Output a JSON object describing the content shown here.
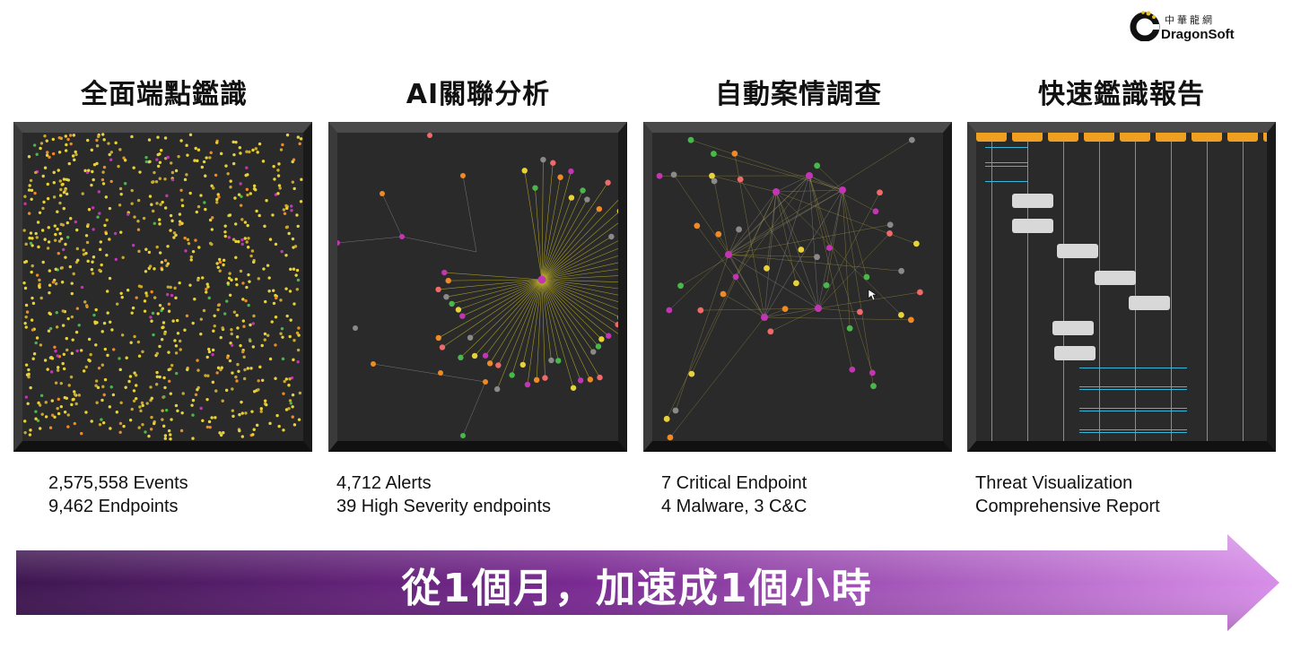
{
  "logo": {
    "cn": "中華龍網",
    "en": "DragonSoft"
  },
  "columns": [
    {
      "title": "全面端點鑑識",
      "stats": [
        "2,575,558 Events",
        "9,462 Endpoints"
      ]
    },
    {
      "title": "AI關聯分析",
      "stats": [
        "4,712 Alerts",
        "39 High Severity endpoints"
      ]
    },
    {
      "title": "自動案情調查",
      "stats": [
        "7 Critical Endpoint",
        "4 Malware, 3 C&C"
      ]
    },
    {
      "title": "快速鑑識報告",
      "stats": [
        "Threat Visualization",
        "Comprehensive Report"
      ]
    }
  ],
  "banner": "從1個月，加速成1個小時",
  "colors": {
    "arrow_light": "#e6b8f2",
    "arrow_dark": "#5a1e6e",
    "node_yellow": "#e8d23a",
    "node_orange": "#f08a24",
    "node_magenta": "#c236b4",
    "node_green": "#48b84a",
    "node_pink": "#f06a6a",
    "node_gray": "#8a8a8a"
  }
}
